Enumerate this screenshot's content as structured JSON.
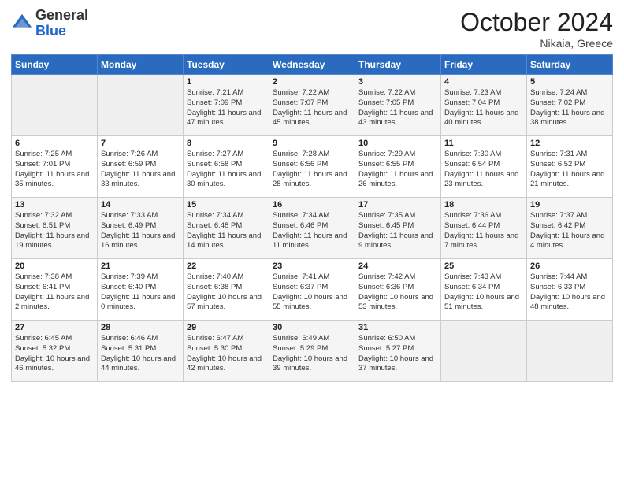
{
  "header": {
    "logo_general": "General",
    "logo_blue": "Blue",
    "title": "October 2024",
    "location": "Nikaia, Greece"
  },
  "weekdays": [
    "Sunday",
    "Monday",
    "Tuesday",
    "Wednesday",
    "Thursday",
    "Friday",
    "Saturday"
  ],
  "weeks": [
    [
      {
        "day": "",
        "empty": true
      },
      {
        "day": "",
        "empty": true
      },
      {
        "day": "1",
        "sunrise": "7:21 AM",
        "sunset": "7:09 PM",
        "daylight": "11 hours and 47 minutes."
      },
      {
        "day": "2",
        "sunrise": "7:22 AM",
        "sunset": "7:07 PM",
        "daylight": "11 hours and 45 minutes."
      },
      {
        "day": "3",
        "sunrise": "7:22 AM",
        "sunset": "7:05 PM",
        "daylight": "11 hours and 43 minutes."
      },
      {
        "day": "4",
        "sunrise": "7:23 AM",
        "sunset": "7:04 PM",
        "daylight": "11 hours and 40 minutes."
      },
      {
        "day": "5",
        "sunrise": "7:24 AM",
        "sunset": "7:02 PM",
        "daylight": "11 hours and 38 minutes."
      }
    ],
    [
      {
        "day": "6",
        "sunrise": "7:25 AM",
        "sunset": "7:01 PM",
        "daylight": "11 hours and 35 minutes."
      },
      {
        "day": "7",
        "sunrise": "7:26 AM",
        "sunset": "6:59 PM",
        "daylight": "11 hours and 33 minutes."
      },
      {
        "day": "8",
        "sunrise": "7:27 AM",
        "sunset": "6:58 PM",
        "daylight": "11 hours and 30 minutes."
      },
      {
        "day": "9",
        "sunrise": "7:28 AM",
        "sunset": "6:56 PM",
        "daylight": "11 hours and 28 minutes."
      },
      {
        "day": "10",
        "sunrise": "7:29 AM",
        "sunset": "6:55 PM",
        "daylight": "11 hours and 26 minutes."
      },
      {
        "day": "11",
        "sunrise": "7:30 AM",
        "sunset": "6:54 PM",
        "daylight": "11 hours and 23 minutes."
      },
      {
        "day": "12",
        "sunrise": "7:31 AM",
        "sunset": "6:52 PM",
        "daylight": "11 hours and 21 minutes."
      }
    ],
    [
      {
        "day": "13",
        "sunrise": "7:32 AM",
        "sunset": "6:51 PM",
        "daylight": "11 hours and 19 minutes."
      },
      {
        "day": "14",
        "sunrise": "7:33 AM",
        "sunset": "6:49 PM",
        "daylight": "11 hours and 16 minutes."
      },
      {
        "day": "15",
        "sunrise": "7:34 AM",
        "sunset": "6:48 PM",
        "daylight": "11 hours and 14 minutes."
      },
      {
        "day": "16",
        "sunrise": "7:34 AM",
        "sunset": "6:46 PM",
        "daylight": "11 hours and 11 minutes."
      },
      {
        "day": "17",
        "sunrise": "7:35 AM",
        "sunset": "6:45 PM",
        "daylight": "11 hours and 9 minutes."
      },
      {
        "day": "18",
        "sunrise": "7:36 AM",
        "sunset": "6:44 PM",
        "daylight": "11 hours and 7 minutes."
      },
      {
        "day": "19",
        "sunrise": "7:37 AM",
        "sunset": "6:42 PM",
        "daylight": "11 hours and 4 minutes."
      }
    ],
    [
      {
        "day": "20",
        "sunrise": "7:38 AM",
        "sunset": "6:41 PM",
        "daylight": "11 hours and 2 minutes."
      },
      {
        "day": "21",
        "sunrise": "7:39 AM",
        "sunset": "6:40 PM",
        "daylight": "11 hours and 0 minutes."
      },
      {
        "day": "22",
        "sunrise": "7:40 AM",
        "sunset": "6:38 PM",
        "daylight": "10 hours and 57 minutes."
      },
      {
        "day": "23",
        "sunrise": "7:41 AM",
        "sunset": "6:37 PM",
        "daylight": "10 hours and 55 minutes."
      },
      {
        "day": "24",
        "sunrise": "7:42 AM",
        "sunset": "6:36 PM",
        "daylight": "10 hours and 53 minutes."
      },
      {
        "day": "25",
        "sunrise": "7:43 AM",
        "sunset": "6:34 PM",
        "daylight": "10 hours and 51 minutes."
      },
      {
        "day": "26",
        "sunrise": "7:44 AM",
        "sunset": "6:33 PM",
        "daylight": "10 hours and 48 minutes."
      }
    ],
    [
      {
        "day": "27",
        "sunrise": "6:45 AM",
        "sunset": "5:32 PM",
        "daylight": "10 hours and 46 minutes."
      },
      {
        "day": "28",
        "sunrise": "6:46 AM",
        "sunset": "5:31 PM",
        "daylight": "10 hours and 44 minutes."
      },
      {
        "day": "29",
        "sunrise": "6:47 AM",
        "sunset": "5:30 PM",
        "daylight": "10 hours and 42 minutes."
      },
      {
        "day": "30",
        "sunrise": "6:49 AM",
        "sunset": "5:29 PM",
        "daylight": "10 hours and 39 minutes."
      },
      {
        "day": "31",
        "sunrise": "6:50 AM",
        "sunset": "5:27 PM",
        "daylight": "10 hours and 37 minutes."
      },
      {
        "day": "",
        "empty": true
      },
      {
        "day": "",
        "empty": true
      }
    ]
  ]
}
